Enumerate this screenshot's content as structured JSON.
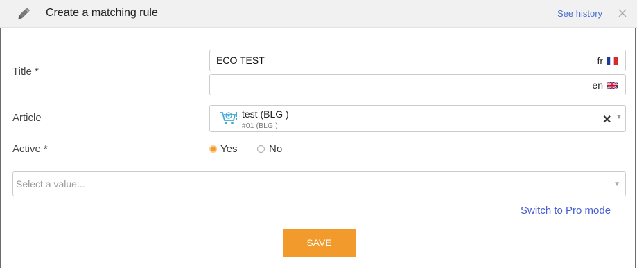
{
  "header": {
    "title": "Create a matching rule",
    "history_link": "See history",
    "icon": "pencil-icon",
    "close_icon": "close-icon"
  },
  "form": {
    "title_label": "Title *",
    "title_fr": {
      "value": "ECO TEST",
      "lang": "fr",
      "flag": "france-flag-icon"
    },
    "title_en": {
      "value": "",
      "lang": "en",
      "flag": "uk-flag-icon"
    },
    "article_label": "Article",
    "article": {
      "name": "test (BLG )",
      "ref": "#01 (BLG )",
      "icon": "cart-icon"
    },
    "active_label": "Active *",
    "active_options": [
      {
        "label": "Yes",
        "selected": true
      },
      {
        "label": "No",
        "selected": false
      }
    ],
    "select_placeholder": "Select a value...",
    "pro_mode_link": "Switch to Pro mode",
    "save_label": "SAVE"
  },
  "colors": {
    "accent": "#f39a2c",
    "link": "#4a5fd1",
    "header_bg": "#f1f1f1"
  }
}
